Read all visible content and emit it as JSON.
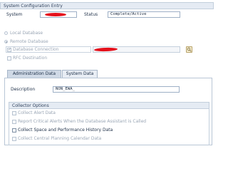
{
  "group_title": "System Configuration Entry",
  "system": {
    "label": "System",
    "value": ""
  },
  "status": {
    "label": "Status",
    "value": "Complete/Active"
  },
  "local_db": {
    "label": "Local Database",
    "selected": false
  },
  "remote_db": {
    "label": "Remote Database",
    "selected": true
  },
  "db_connection": {
    "label": "Database Connection",
    "checked": true,
    "value": ""
  },
  "rfc_destination": {
    "label": "RFC Destination",
    "checked": false
  },
  "tabs": [
    {
      "label": "Administration Data",
      "active": true
    },
    {
      "label": "System Data",
      "active": false
    }
  ],
  "description": {
    "label": "Description",
    "value": "NON_EWA_"
  },
  "collector": {
    "title": "Collector Options",
    "options": [
      {
        "label": "Collect Alert Data",
        "enabled": false,
        "checked": false
      },
      {
        "label": "Report Critical Alerts When the Database Assistant is Called",
        "enabled": false,
        "checked": false
      },
      {
        "label": "Collect Space and Performance History Data",
        "enabled": true,
        "checked": false
      },
      {
        "label": "Collect Central Planning Calendar Data",
        "enabled": false,
        "checked": false
      }
    ]
  },
  "colors": {
    "redaction": "#e4101b",
    "header_bg": "#e5ebf3",
    "tab_active": "#cfd9e6"
  },
  "icons": {
    "value_help": "value-help-icon"
  }
}
